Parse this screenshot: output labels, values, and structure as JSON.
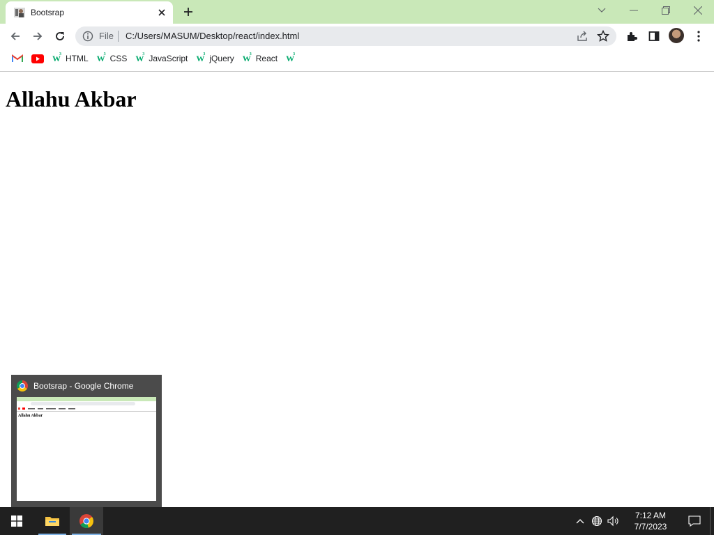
{
  "browser": {
    "tab": {
      "title": "Bootsrap",
      "favicon": "user-photo-icon",
      "close_icon": "close-icon"
    },
    "new_tab_icon": "plus-icon",
    "window_controls": [
      "chevron-down-icon",
      "minimize-icon",
      "restore-icon",
      "close-icon"
    ],
    "omnibox": {
      "scheme_label": "File",
      "url": "C:/Users/MASUM/Desktop/react/index.html",
      "info_icon": "info-icon",
      "share_icon": "share-icon",
      "bookmark_icon": "star-icon"
    },
    "nav_icons": [
      "back-arrow-icon",
      "forward-arrow-icon",
      "reload-icon"
    ],
    "toolbar_icons": [
      "extensions-icon",
      "side-panel-icon",
      "profile-avatar",
      "menu-icon"
    ],
    "bookmarks": [
      {
        "label": "",
        "icon": "gmail-icon"
      },
      {
        "label": "",
        "icon": "youtube-icon"
      },
      {
        "label": "HTML",
        "icon": "w3schools-icon"
      },
      {
        "label": "CSS",
        "icon": "w3schools-icon"
      },
      {
        "label": "JavaScript",
        "icon": "w3schools-icon"
      },
      {
        "label": "jQuery",
        "icon": "w3schools-icon"
      },
      {
        "label": "React",
        "icon": "w3schools-icon"
      },
      {
        "label": "",
        "icon": "w3schools-icon"
      }
    ]
  },
  "page": {
    "heading": "Allahu Akbar"
  },
  "preview": {
    "title": "Bootsrap - Google Chrome",
    "thumb_heading": "Allahu Akbar"
  },
  "taskbar": {
    "apps": [
      "windows-start-icon",
      "file-explorer-icon",
      "chrome-icon"
    ],
    "tray_icons": [
      "chevron-up-icon",
      "network-icon",
      "volume-icon"
    ],
    "time": "7:12 AM",
    "date": "7/7/2023",
    "notification_icon": "notification-icon"
  },
  "colors": {
    "tabstrip": "#c9e8b8",
    "omnibox": "#e8eaed",
    "taskbar": "#202020",
    "w3schools_green": "#04aa6d"
  }
}
